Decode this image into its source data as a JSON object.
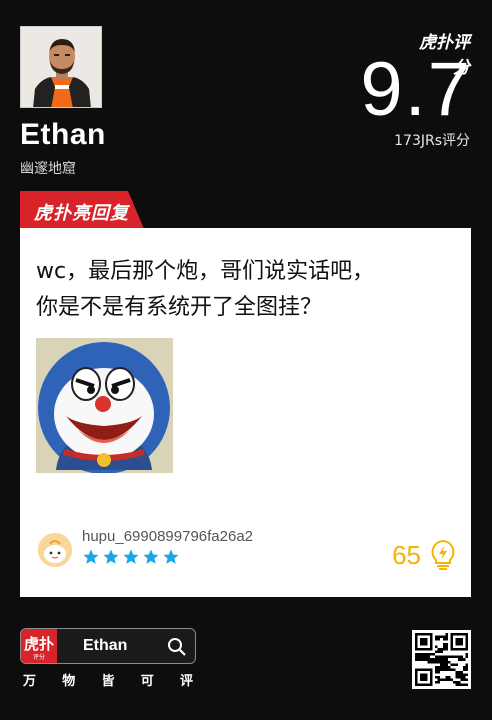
{
  "player": {
    "name": "Ethan",
    "team": "幽邃地窟"
  },
  "rating": {
    "brand": "虎扑评分",
    "score": "9.7",
    "count_text": "173JRs评分"
  },
  "highlight_tag": "虎扑亮回复",
  "comment": {
    "line1": "wc，最后那个炮，哥们说实话吧，",
    "line2": "你是不是有系统开了全图挂？",
    "username": "hupu_6990899796fa26a2",
    "stars": 5,
    "likes": "65"
  },
  "footer": {
    "search_text": "Ethan",
    "slogan": [
      "万",
      "物",
      "皆",
      "可",
      "评"
    ],
    "search_logo_sub": "评分"
  },
  "colors": {
    "accent_red": "#d8232a",
    "star_blue": "#1aa7e8",
    "like_gold": "#f5b400"
  },
  "icons": [
    "search-icon",
    "lightbulb-icon",
    "star-icon",
    "qr-code"
  ]
}
